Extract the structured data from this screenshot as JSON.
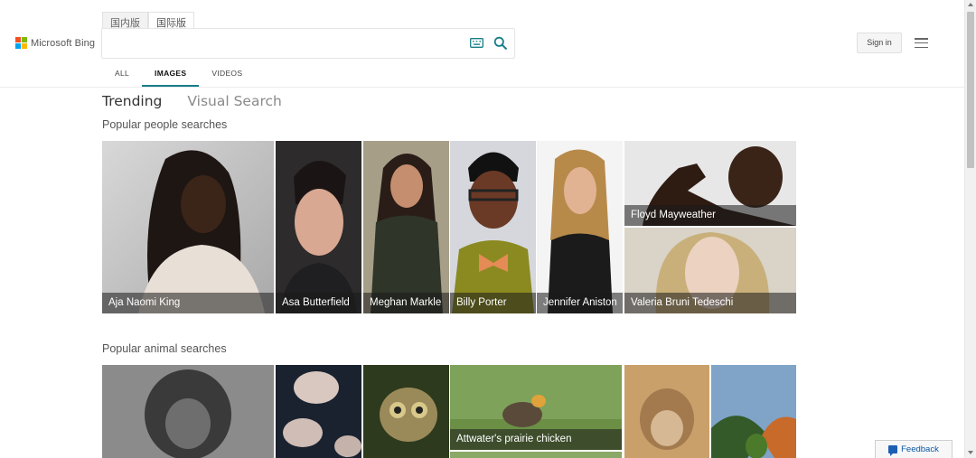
{
  "header": {
    "logo_text": "Microsoft Bing",
    "region_tabs": [
      "国内版",
      "国际版"
    ],
    "search": {
      "value": "",
      "placeholder": ""
    },
    "sign_in_label": "Sign in"
  },
  "scope_tabs": [
    "ALL",
    "IMAGES",
    "VIDEOS"
  ],
  "mode_tabs": [
    "Trending",
    "Visual Search"
  ],
  "sections": {
    "people": {
      "title": "Popular people searches",
      "items": [
        "Aja Naomi King",
        "Asa Butterfield",
        "Meghan Markle",
        "Billy Porter",
        "Jennifer Aniston",
        "Floyd Mayweather",
        "Valeria Bruni Tedeschi"
      ]
    },
    "animals": {
      "title": "Popular animal searches",
      "items": [
        "Attwater's prairie chicken"
      ]
    }
  },
  "feedback_label": "Feedback",
  "colors": {
    "accent": "#177e89",
    "caption_bg": "rgba(25,25,25,0.55)",
    "feedback_link": "#0b57a5"
  }
}
